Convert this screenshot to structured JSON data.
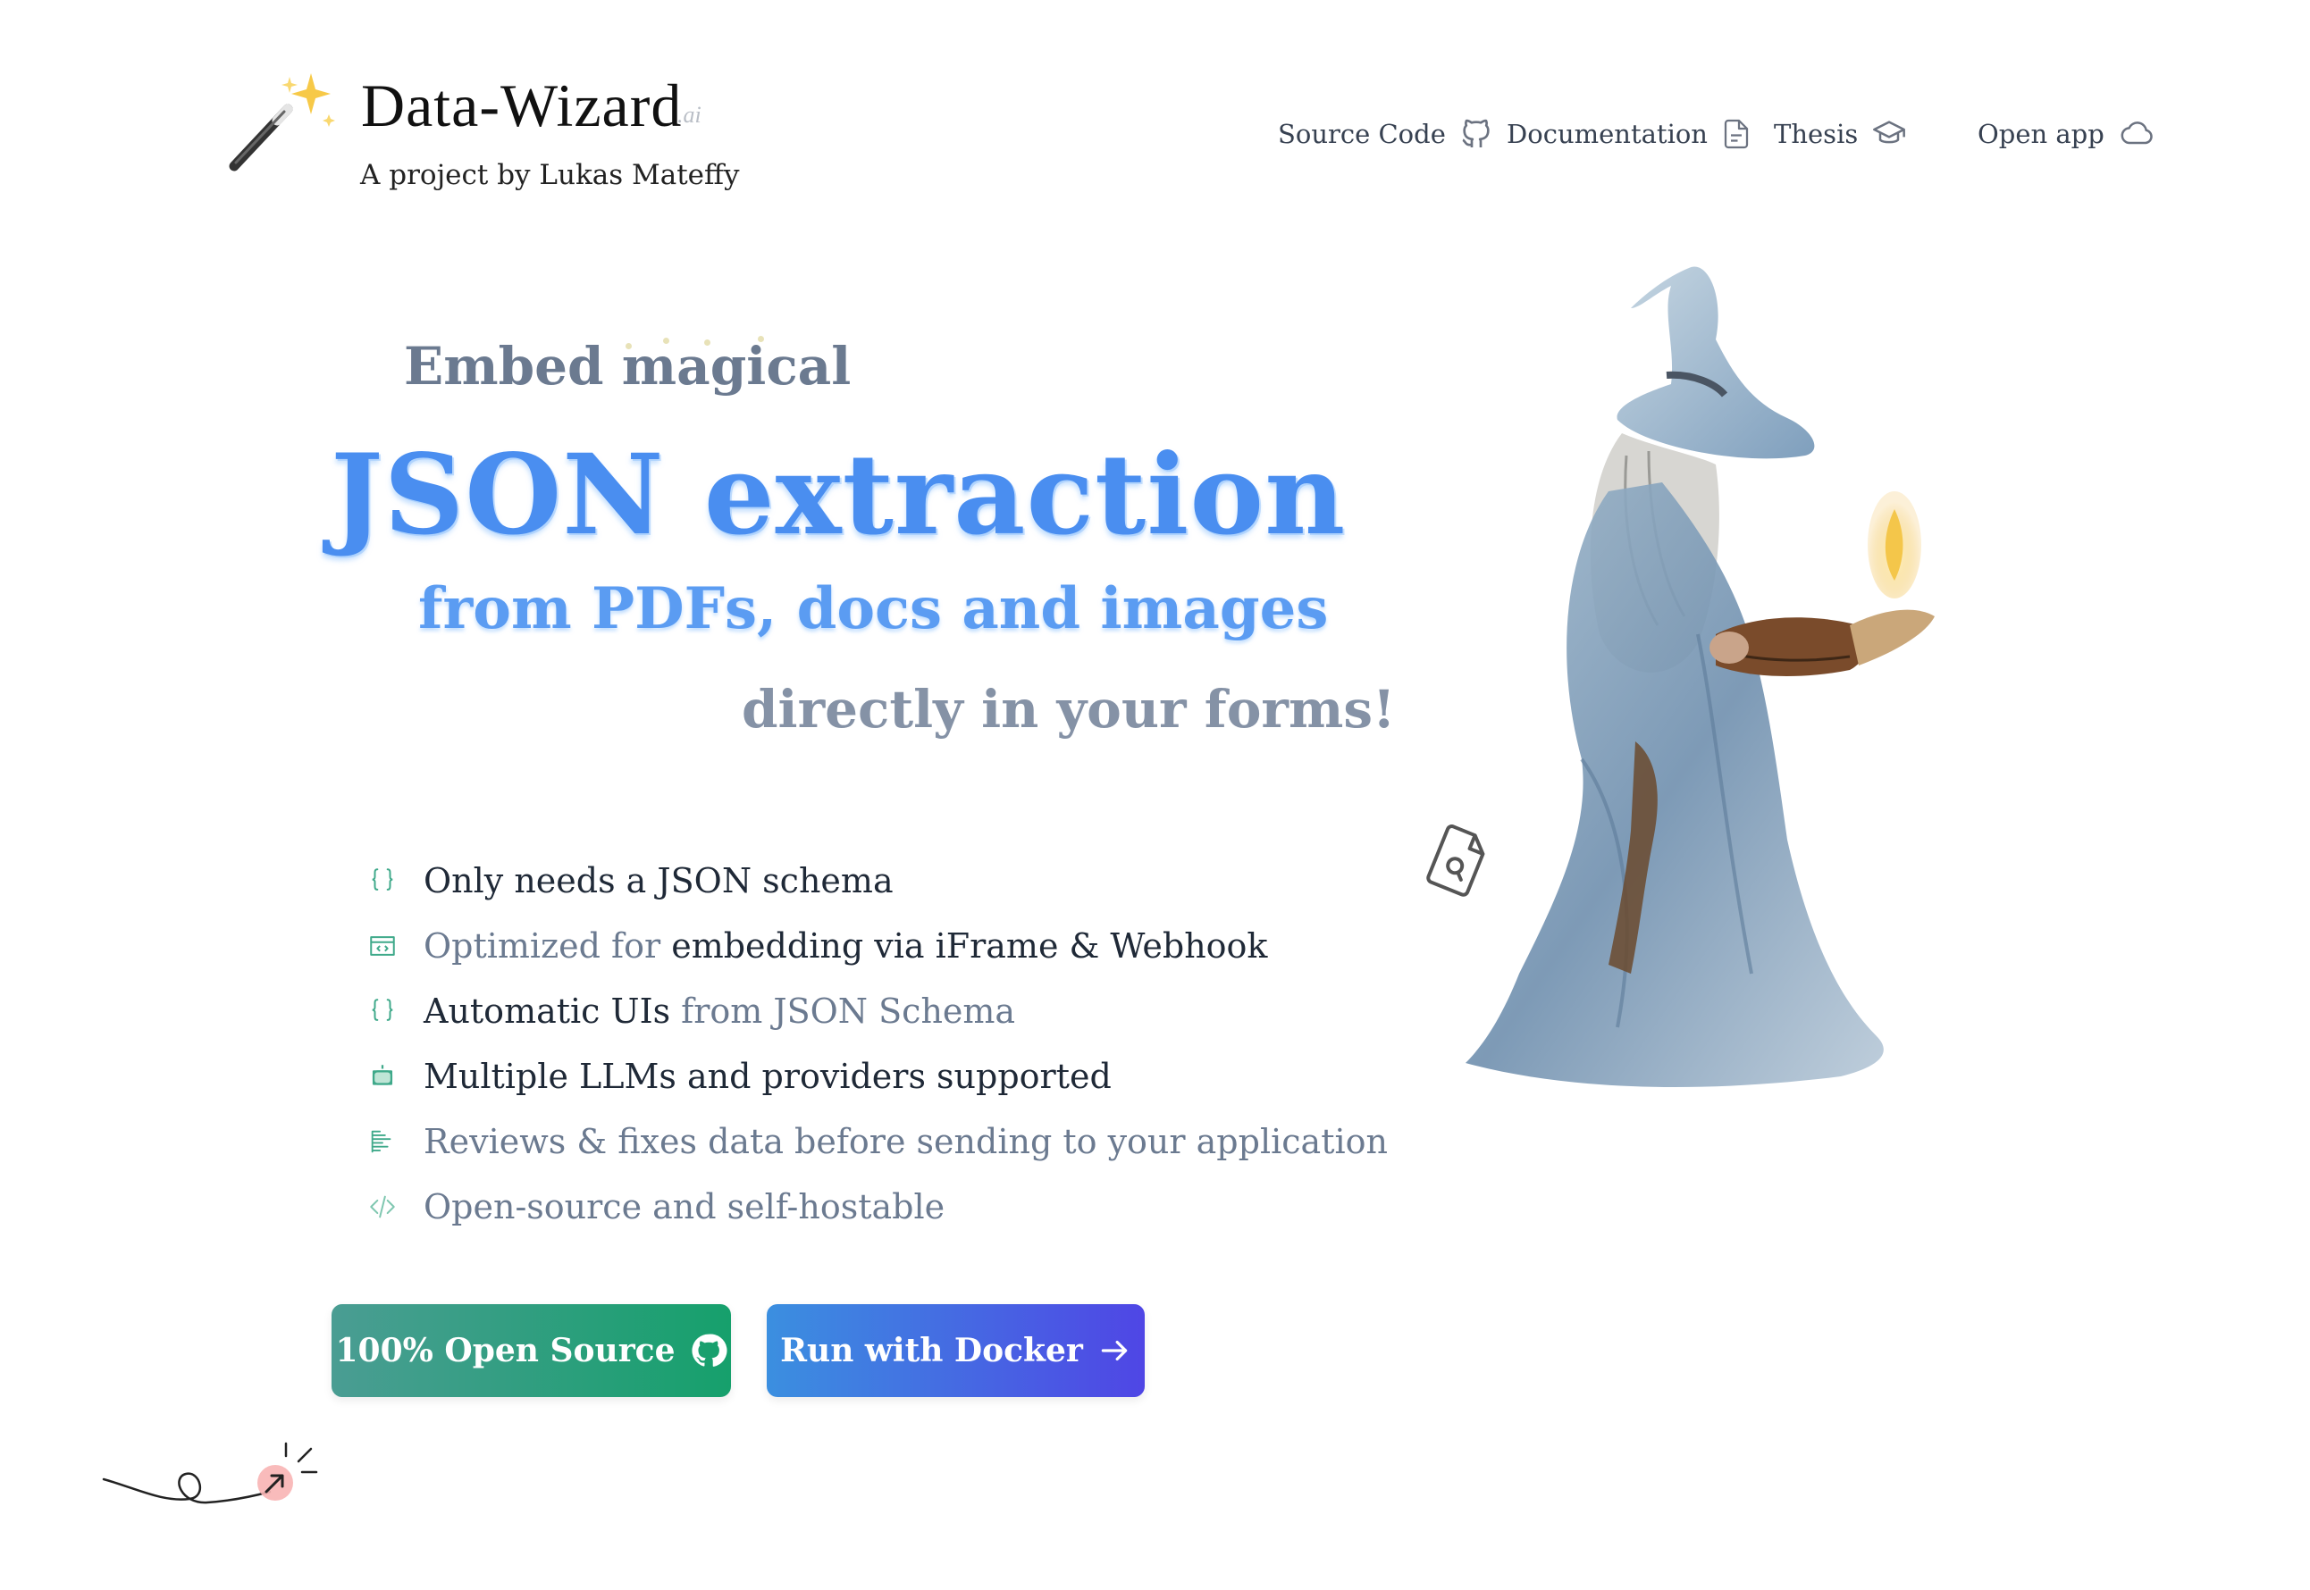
{
  "brand": {
    "name": "Data-Wizard",
    "suffix": ".ai",
    "tagline": "A project by Lukas Mateffy"
  },
  "nav": [
    {
      "label": "Source Code",
      "icon": "github-icon"
    },
    {
      "label": "Documentation",
      "icon": "document-icon"
    },
    {
      "label": "Thesis",
      "icon": "graduation-cap-icon"
    },
    {
      "label": "Open app",
      "icon": "cloud-icon"
    }
  ],
  "hero": {
    "line1": "Embed magical",
    "line2": "JSON extraction",
    "line3": "from PDFs, docs and images",
    "line4": "directly in your forms!"
  },
  "features": [
    {
      "icon": "braces-icon",
      "parts": [
        {
          "text": "Only needs a JSON schema",
          "style": "dark"
        }
      ]
    },
    {
      "icon": "embed-window-icon",
      "parts": [
        {
          "text": "Optimized for ",
          "style": "muted"
        },
        {
          "text": "embedding via iFrame & Webhook",
          "style": "dark"
        }
      ]
    },
    {
      "icon": "braces-icon",
      "parts": [
        {
          "text": "Automatic UIs ",
          "style": "dark"
        },
        {
          "text": "from JSON Schema",
          "style": "muted"
        }
      ]
    },
    {
      "icon": "robot-icon",
      "parts": [
        {
          "text": "Multiple LLMs and providers supported",
          "style": "dark"
        }
      ]
    },
    {
      "icon": "list-review-icon",
      "parts": [
        {
          "text": "Reviews & fixes data before sending to your application",
          "style": "muted"
        }
      ]
    },
    {
      "icon": "code-icon",
      "parts": [
        {
          "text": "Open-source and self-hostable",
          "style": "muted"
        }
      ]
    }
  ],
  "buttons": {
    "open_source": "100% Open Source",
    "docker": "Run with Docker"
  },
  "colors": {
    "accent_blue": "#4a8ef0",
    "accent_green": "#16a06c",
    "accent_indigo": "#4f46e5",
    "muted_text": "#6b7a90"
  }
}
